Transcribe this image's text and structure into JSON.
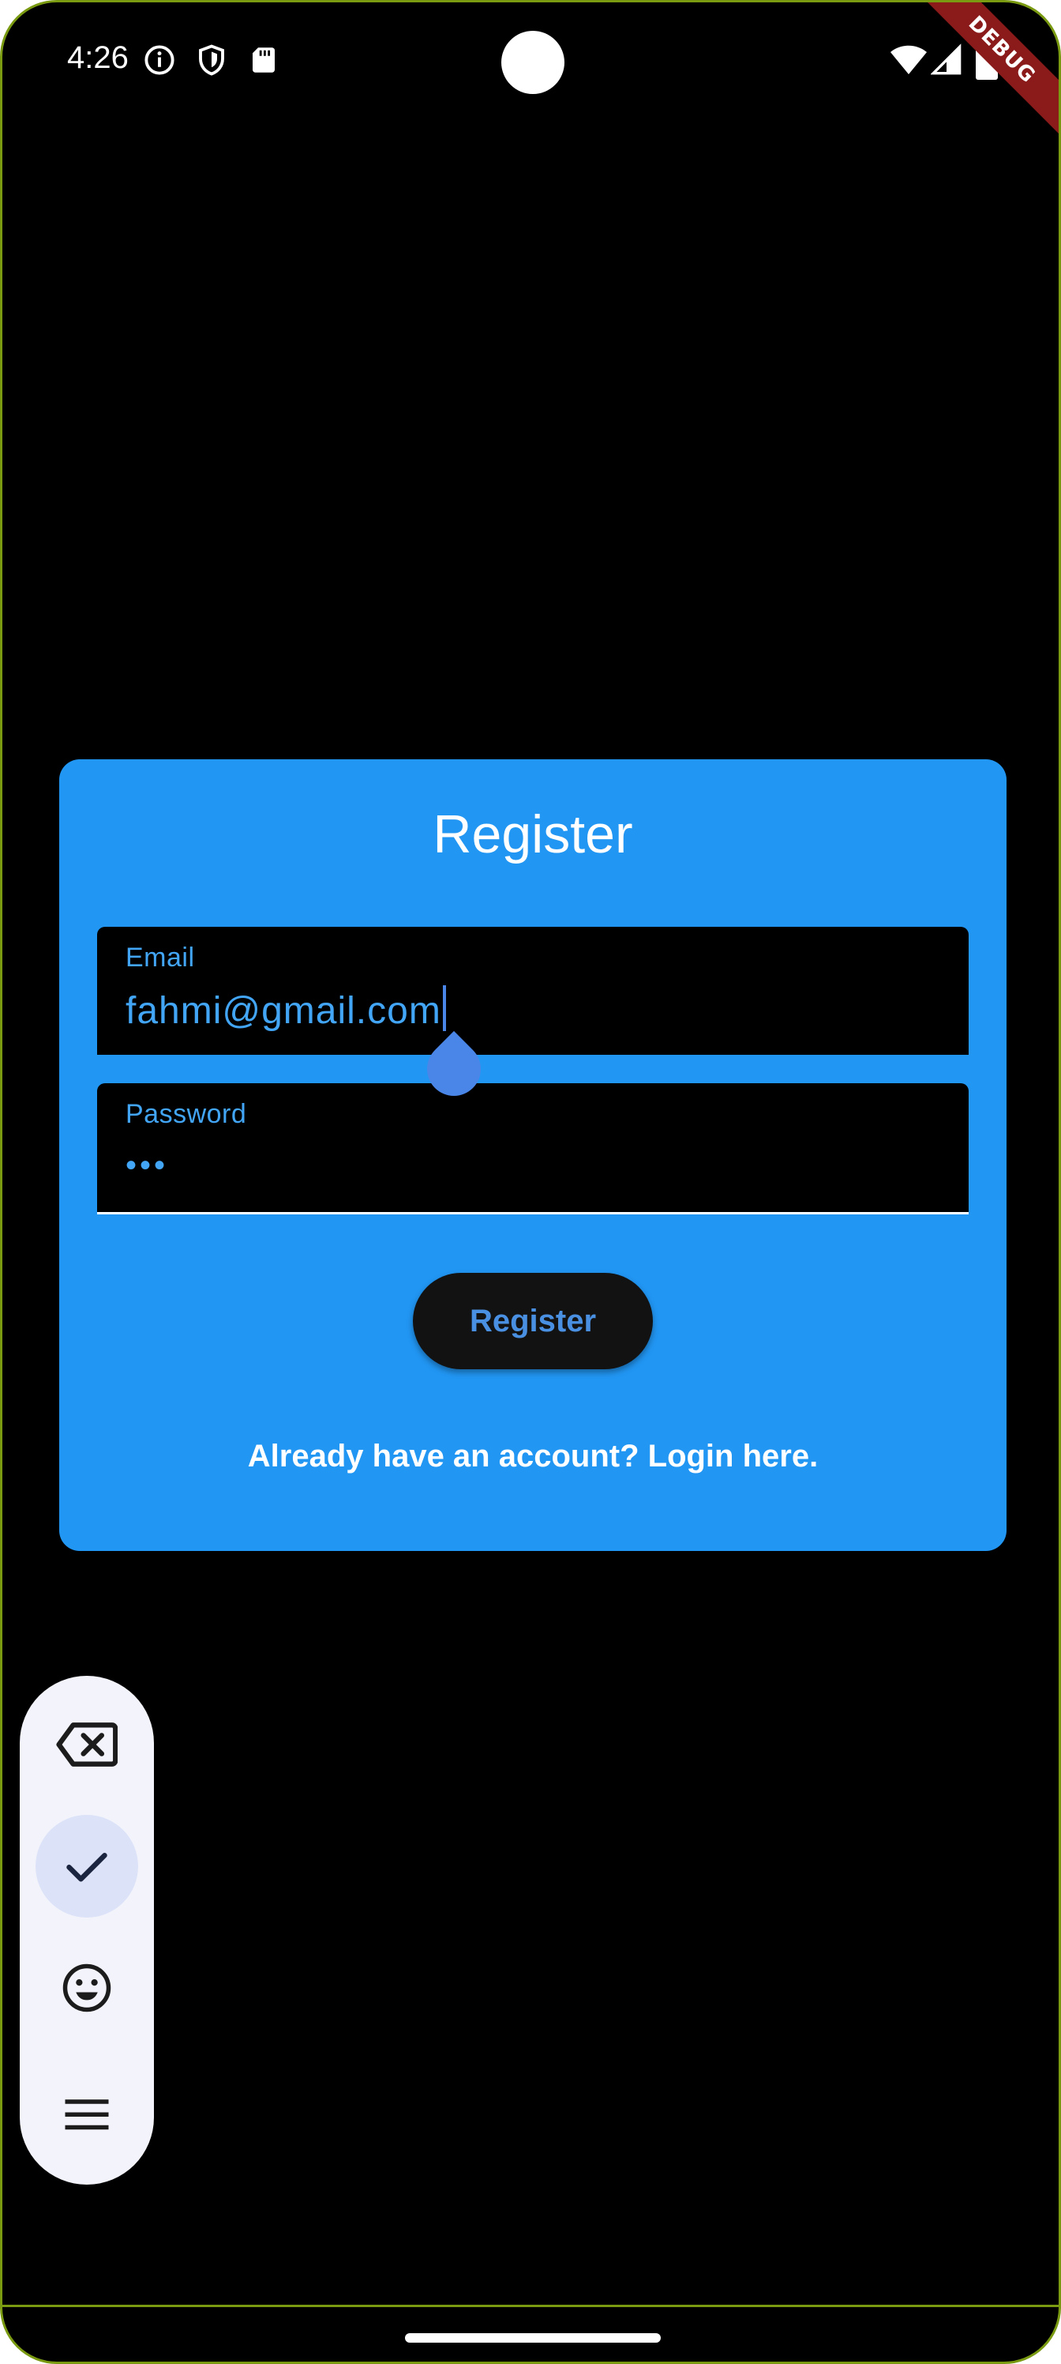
{
  "status_bar": {
    "time": "4:26",
    "left_icons": [
      "info-icon",
      "shield-icon",
      "sd-card-icon"
    ],
    "right_icons": [
      "wifi-icon",
      "signal-icon",
      "battery-icon"
    ],
    "debug_banner": "DEBUG"
  },
  "register_card": {
    "title": "Register",
    "email": {
      "label": "Email",
      "value": "fahmi@gmail.com"
    },
    "password": {
      "label": "Password",
      "value": "•••"
    },
    "submit_label": "Register",
    "login_link": "Already have an account? Login here."
  },
  "keyboard_toolbar": {
    "buttons": [
      "backspace-icon",
      "checkmark-icon",
      "emoji-icon",
      "menu-icon"
    ],
    "selected": "checkmark-icon"
  },
  "colors": {
    "card_background": "#2196f3",
    "field_text": "#42a5f5",
    "screen_background": "#000000",
    "toolbar_background": "#f3f3fb",
    "selected_button_background": "#dce3f8"
  }
}
